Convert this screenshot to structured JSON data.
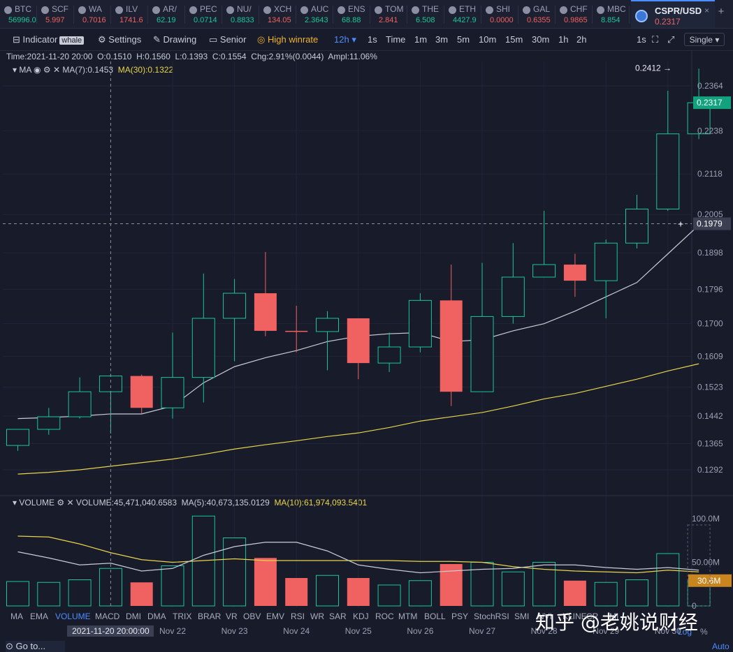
{
  "tickers": [
    {
      "symbol": "BTC",
      "price": "56996.0",
      "dir": "up"
    },
    {
      "symbol": "SCF",
      "price": "5.997",
      "dir": "dn"
    },
    {
      "symbol": "WA",
      "price": "0.7016",
      "dir": "dn"
    },
    {
      "symbol": "ILV",
      "price": "1741.6",
      "dir": "dn"
    },
    {
      "symbol": "AR/",
      "price": "62.19",
      "dir": "up"
    },
    {
      "symbol": "PEC",
      "price": "0.0714",
      "dir": "up"
    },
    {
      "symbol": "NU/",
      "price": "0.8833",
      "dir": "up"
    },
    {
      "symbol": "XCH",
      "price": "134.05",
      "dir": "dn"
    },
    {
      "symbol": "AUC",
      "price": "2.3643",
      "dir": "up"
    },
    {
      "symbol": "ENS",
      "price": "68.88",
      "dir": "up"
    },
    {
      "symbol": "TOM",
      "price": "2.841",
      "dir": "dn"
    },
    {
      "symbol": "THE",
      "price": "6.508",
      "dir": "up"
    },
    {
      "symbol": "ETH",
      "price": "4427.9",
      "dir": "up"
    },
    {
      "symbol": "SHI",
      "price": "0.0000",
      "dir": "dn"
    },
    {
      "symbol": "GAL",
      "price": "0.6355",
      "dir": "dn"
    },
    {
      "symbol": "CHF",
      "price": "0.9865",
      "dir": "dn"
    },
    {
      "symbol": "MBC",
      "price": "8.854",
      "dir": "up"
    }
  ],
  "active_tab": {
    "symbol": "CSPR/USD",
    "price": "0.2317",
    "close": "×"
  },
  "add_tab": "+",
  "toolbar": {
    "indicator": "Indicator",
    "whale": "whale",
    "settings": "Settings",
    "drawing": "Drawing",
    "senior": "Senior",
    "high_winrate": "High winrate",
    "intervals": [
      "12h",
      "1s",
      "Time",
      "1m",
      "3m",
      "5m",
      "10m",
      "15m",
      "30m",
      "1h",
      "2h"
    ],
    "active_interval": "12h",
    "right_interval": "1s",
    "single": "Single"
  },
  "info": {
    "time": "Time:2021-11-20 20:00",
    "open": "O:0.1510",
    "high": "H:0.1560",
    "low": "L:0.1393",
    "close": "C:0.1554",
    "chg": "Chg:2.91%(0.0044)",
    "ampl": "Ampl:11.06%"
  },
  "ma_legend": {
    "name": "MA",
    "ma7": "MA(7):0.1453",
    "ma30": "MA(30):0.1322"
  },
  "vol_legend": {
    "name": "VOLUME",
    "vol": "VOLUME:45,471,040.6583",
    "ma5": "MA(5):40,673,135.0129",
    "ma10": "MA(10):61,974,093.5401"
  },
  "indicators": [
    "MA",
    "EMA",
    "VOLUME",
    "MACD",
    "DMI",
    "DMA",
    "TRIX",
    "BRAR",
    "VR",
    "OBV",
    "EMV",
    "RSI",
    "WR",
    "SAR",
    "KDJ",
    "ROC",
    "MTM",
    "BOLL",
    "PSY",
    "StochRSI",
    "SMI",
    "NVI",
    "KLINE",
    "CR",
    "MI"
  ],
  "active_indicator": "VOLUME",
  "crosshair": {
    "date": "2021-11-20 20:00:00",
    "price": "0.1979"
  },
  "last_price_label": "0.2317",
  "high_marker": "0.2412 →",
  "vol_last_label": "30.6M",
  "log_label": "Log",
  "pct_label": "%",
  "auto_label": "Auto",
  "goto": "Go to...",
  "watermark": "知乎 @老姚说财经",
  "colors": {
    "up": "#19c79a",
    "down": "#f06161",
    "ma7": "#c9ccd6",
    "ma30": "#e8d44d",
    "bg": "#181b29",
    "accent": "#4c8dff"
  },
  "chart_data": {
    "type": "candlestick",
    "interval": "12h",
    "price_axis_ticks": [
      0.2364,
      0.2238,
      0.2118,
      0.2005,
      0.1898,
      0.1796,
      0.17,
      0.1609,
      0.1523,
      0.1442,
      0.1365,
      0.1292
    ],
    "date_labels": [
      {
        "label": "Nov 22",
        "index": 5.5
      },
      {
        "label": "Nov 23",
        "index": 7.5
      },
      {
        "label": "Nov 24",
        "index": 9.5
      },
      {
        "label": "Nov 25",
        "index": 11.5
      },
      {
        "label": "Nov 26",
        "index": 13.5
      },
      {
        "label": "Nov 27",
        "index": 15.5
      },
      {
        "label": "Nov 28",
        "index": 17.5
      },
      {
        "label": "Nov 29",
        "index": 19.5
      },
      {
        "label": "Nov 30",
        "index": 21.5
      }
    ],
    "candles": [
      {
        "o": 0.136,
        "h": 0.1405,
        "l": 0.1345,
        "c": 0.1405
      },
      {
        "o": 0.1405,
        "h": 0.1465,
        "l": 0.139,
        "c": 0.144
      },
      {
        "o": 0.144,
        "h": 0.155,
        "l": 0.1435,
        "c": 0.151
      },
      {
        "o": 0.151,
        "h": 0.156,
        "l": 0.1393,
        "c": 0.1554
      },
      {
        "o": 0.1554,
        "h": 0.1558,
        "l": 0.145,
        "c": 0.1465
      },
      {
        "o": 0.1465,
        "h": 0.1675,
        "l": 0.1435,
        "c": 0.155
      },
      {
        "o": 0.155,
        "h": 0.184,
        "l": 0.148,
        "c": 0.1715
      },
      {
        "o": 0.1715,
        "h": 0.1825,
        "l": 0.1595,
        "c": 0.1785
      },
      {
        "o": 0.1785,
        "h": 0.19,
        "l": 0.1665,
        "c": 0.168
      },
      {
        "o": 0.168,
        "h": 0.175,
        "l": 0.162,
        "c": 0.1678
      },
      {
        "o": 0.1678,
        "h": 0.1735,
        "l": 0.157,
        "c": 0.1715
      },
      {
        "o": 0.1715,
        "h": 0.1715,
        "l": 0.1545,
        "c": 0.159
      },
      {
        "o": 0.159,
        "h": 0.1675,
        "l": 0.1565,
        "c": 0.1635
      },
      {
        "o": 0.1635,
        "h": 0.1785,
        "l": 0.162,
        "c": 0.1765
      },
      {
        "o": 0.1765,
        "h": 0.1865,
        "l": 0.147,
        "c": 0.151
      },
      {
        "o": 0.151,
        "h": 0.187,
        "l": 0.151,
        "c": 0.172
      },
      {
        "o": 0.172,
        "h": 0.1925,
        "l": 0.17,
        "c": 0.183
      },
      {
        "o": 0.183,
        "h": 0.2015,
        "l": 0.183,
        "c": 0.1865
      },
      {
        "o": 0.1865,
        "h": 0.1895,
        "l": 0.1775,
        "c": 0.182
      },
      {
        "o": 0.182,
        "h": 0.1935,
        "l": 0.1715,
        "c": 0.1925
      },
      {
        "o": 0.1925,
        "h": 0.206,
        "l": 0.191,
        "c": 0.202
      },
      {
        "o": 0.202,
        "h": 0.235,
        "l": 0.2015,
        "c": 0.223
      },
      {
        "o": 0.223,
        "h": 0.2412,
        "l": 0.2215,
        "c": 0.2317
      }
    ],
    "ma7": [
      0.1435,
      0.1438,
      0.1442,
      0.1448,
      0.1448,
      0.147,
      0.1535,
      0.158,
      0.1605,
      0.1625,
      0.165,
      0.1665,
      0.1672,
      0.1675,
      0.165,
      0.1655,
      0.168,
      0.17,
      0.1735,
      0.1775,
      0.1815,
      0.1895,
      0.1975
    ],
    "ma30": [
      0.128,
      0.1285,
      0.1292,
      0.1302,
      0.1312,
      0.1322,
      0.1335,
      0.135,
      0.1362,
      0.1373,
      0.1385,
      0.1395,
      0.141,
      0.1428,
      0.144,
      0.1452,
      0.147,
      0.149,
      0.1505,
      0.1525,
      0.1545,
      0.1568,
      0.1588
    ],
    "volume": [
      28,
      27,
      30,
      43,
      27,
      46,
      103,
      78,
      55,
      32,
      35,
      32,
      24,
      29,
      48,
      50,
      39,
      50,
      29,
      27,
      30,
      60,
      29
    ],
    "vol_ma5": [
      62,
      55,
      47,
      49,
      40,
      43,
      58,
      68,
      73,
      73,
      63,
      47,
      42,
      38,
      40,
      42,
      43,
      47,
      47,
      44,
      42,
      44,
      41
    ],
    "vol_ma10": [
      80,
      79,
      71,
      61,
      53,
      50,
      52,
      54,
      52,
      52,
      52,
      52,
      52,
      51,
      51,
      50,
      45,
      42,
      40,
      39,
      38,
      41,
      39
    ],
    "volume_axis": {
      "ticks": [
        {
          "value": 100,
          "label": "100.0M"
        },
        {
          "value": 50,
          "label": "50.00M"
        },
        {
          "value": 0,
          "label": "0"
        }
      ],
      "unit": "M"
    }
  }
}
